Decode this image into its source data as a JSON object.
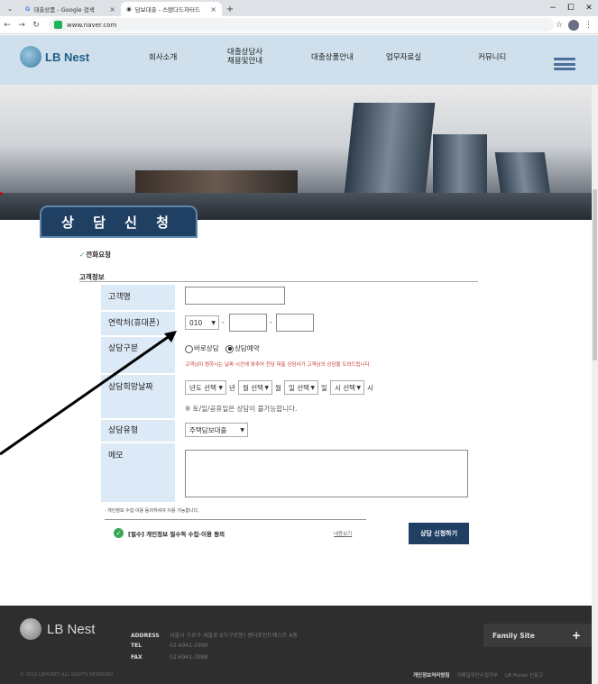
{
  "browser": {
    "tabs": [
      {
        "label": "대출상품 - Google 검색",
        "icon": "G"
      },
      {
        "label": "담보대출 - 스탠다드차터드",
        "icon": "globe"
      }
    ],
    "url": "www.naver.com",
    "controls": {
      "minimize": "−",
      "maximize": "⧠",
      "close": "✕"
    }
  },
  "header": {
    "logo": "LB Nest",
    "nav": [
      "회사소개",
      "대출상담사\n채용및안내",
      "대출상품안내",
      "업무자료실",
      "커뮤니티"
    ]
  },
  "page": {
    "section_title": "상 담 신 청",
    "phone_request": "전화요청",
    "customer_info": "고객정보"
  },
  "form": {
    "name_label": "고객명",
    "phone_label": "연락처(휴대폰)",
    "phone_prefix": "010",
    "phone_sep": "-",
    "consult_type_label": "상담구분",
    "consult_options": [
      "바로상담",
      "상담예약"
    ],
    "consult_selected": "상담예약",
    "consult_note": "고객님이 원하시는 날짜 시간에 맞추어 전담 대출 상담사가 고객님의 상담을 도와드립니다.",
    "date_label": "상담희망날짜",
    "date_selects": [
      "년도 선택",
      "월 선택",
      "일 선택",
      "시 선택"
    ],
    "date_units": [
      "년",
      "월",
      "일",
      "시"
    ],
    "date_note": "※ 토/일/공휴일은 상담이 불가능합니다.",
    "type_label": "상담유형",
    "type_value": "주택담보대출",
    "memo_label": "메모",
    "privacy_note": "· 개인정보 수집·이용 동의하셔야 이용 가능합니다.",
    "agree_text": "[필수] 개인정보 필수적 수집·이용 동의",
    "view_link": "내용보기",
    "submit": "상담 신청하기"
  },
  "footer": {
    "logo": "LB Nest",
    "address_key": "ADDRESS",
    "address_val": "서울시 구로구 새말로 97(구로동) 센터포인트웨스트 4층",
    "tel_key": "TEL",
    "tel_val": "02-6941-2990",
    "fax_key": "FAX",
    "fax_val": "02-6941-3988",
    "family_site": "Family Site",
    "copyright": "© 2023 LBHUNET ALL RIGHTS RESERVED",
    "links": [
      "개인정보처리방침",
      "이메일무단수집거부",
      "LB Hunet 신문고"
    ]
  },
  "colors": {
    "navy": "#1f3f63",
    "label_bg": "#dce9f6",
    "header_bg": "#cfe0ec",
    "footer_bg": "#2e2e2e",
    "note_red": "#c0392b",
    "check_green": "#3aa655"
  }
}
